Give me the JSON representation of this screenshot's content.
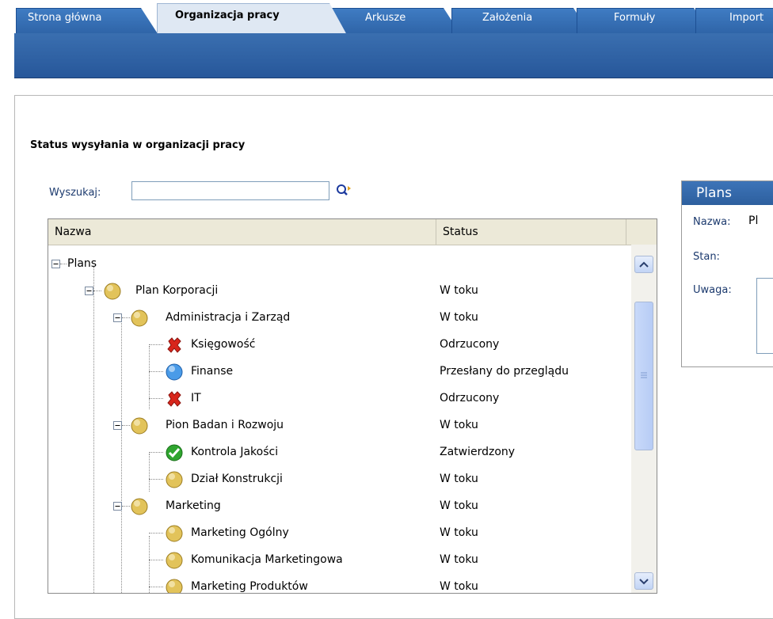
{
  "tabs": [
    {
      "label": "Strona główna"
    },
    {
      "label": "Organizacja pracy"
    },
    {
      "label": "Arkusze"
    },
    {
      "label": "Założenia"
    },
    {
      "label": "Formuły"
    },
    {
      "label": "Import"
    }
  ],
  "section_title": "Status wysyłania w organizacji pracy",
  "search": {
    "label": "Wyszukaj:",
    "value": ""
  },
  "grid": {
    "headers": {
      "name": "Nazwa",
      "status": "Status"
    },
    "rows": [
      {
        "label": "Plans",
        "status": "",
        "icon": "folder"
      },
      {
        "label": "Plan Korporacji",
        "status": "W toku",
        "icon": "in-progress-circle-icon"
      },
      {
        "label": "Administracja i Zarząd",
        "status": "W toku",
        "icon": "in-progress-circle-icon"
      },
      {
        "label": "Księgowość",
        "status": "Odrzucony",
        "icon": "rejected-x-icon"
      },
      {
        "label": "Finanse",
        "status": "Przesłany do przeglądu",
        "icon": "submitted-blue-circle-icon"
      },
      {
        "label": "IT",
        "status": "Odrzucony",
        "icon": "rejected-x-icon"
      },
      {
        "label": "Pion Badan i Rozwoju",
        "status": "W toku",
        "icon": "in-progress-circle-icon"
      },
      {
        "label": "Kontrola Jakości",
        "status": "Zatwierdzony",
        "icon": "approved-check-icon"
      },
      {
        "label": "Dział Konstrukcji",
        "status": "W toku",
        "icon": "in-progress-circle-icon"
      },
      {
        "label": "Marketing",
        "status": "W toku",
        "icon": "in-progress-circle-icon"
      },
      {
        "label": "Marketing Ogólny",
        "status": "W toku",
        "icon": "in-progress-circle-icon"
      },
      {
        "label": "Komunikacja Marketingowa",
        "status": "W toku",
        "icon": "in-progress-circle-icon"
      },
      {
        "label": "Marketing Produktów",
        "status": "W toku",
        "icon": "in-progress-circle-icon"
      }
    ]
  },
  "details": {
    "title": "Plans",
    "name_label": "Nazwa:",
    "name_value": "Pl",
    "state_label": "Stan:",
    "state_value": "",
    "note_label": "Uwaga:"
  },
  "colors": {
    "tab_blue": "#2e63a6",
    "band_blue": "#27579a",
    "in_progress": "#e2c35a",
    "rejected": "#d8261c",
    "approved": "#2fa52f",
    "submitted": "#4a9be8"
  }
}
